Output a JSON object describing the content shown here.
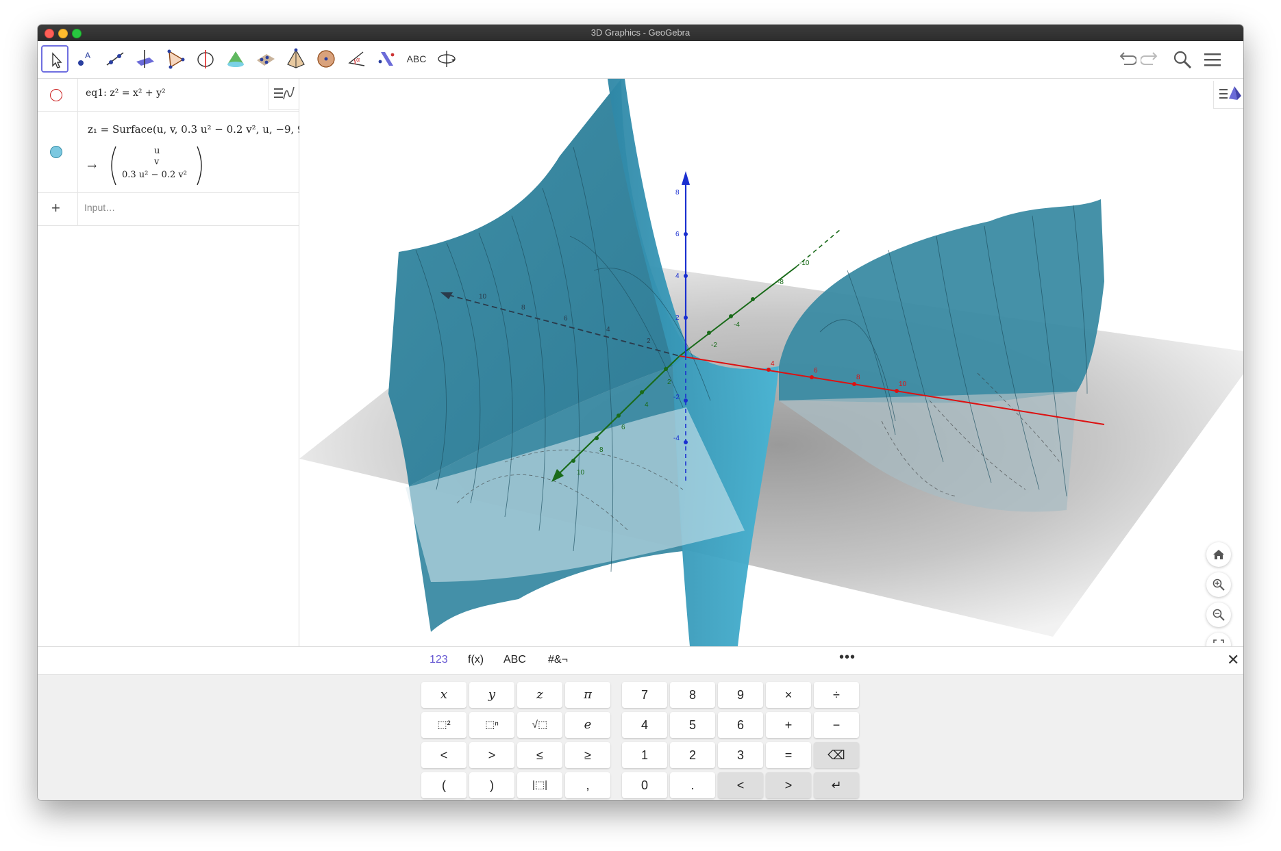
{
  "window": {
    "title": "3D Graphics - GeoGebra"
  },
  "algebra": {
    "rows": [
      {
        "text": "eq1: z² = x² + y²",
        "visible": false,
        "color": "#cc0000"
      },
      {
        "line1": "z₁ = Surface(u, v, 0.3 u² − 0.2 v², u, −9, 9,",
        "line2": "u",
        "line3": "v",
        "line4": "0.3 u² − 0.2 v²",
        "arrow": "→",
        "visible": true,
        "color": "#5bb8d8"
      }
    ],
    "input_placeholder": "Input…",
    "add_label": "+"
  },
  "axes": {
    "z_ticks": [
      "8",
      "6",
      "4",
      "2",
      "-2",
      "-4"
    ],
    "y_ticks": [
      "10",
      "8",
      "6",
      "4",
      "2",
      "-2",
      "-4",
      "-8",
      "-10"
    ],
    "x_ticks": [
      "4",
      "6",
      "8",
      "10"
    ],
    "back_ticks": [
      "10",
      "8",
      "6",
      "4",
      "2"
    ],
    "colors": {
      "x": "#dd1111",
      "y": "#1a6b1a",
      "z": "#1a2fd0",
      "surface": "#3a8fa8"
    }
  },
  "keyboard": {
    "tabs": [
      "123",
      "f(x)",
      "ABC",
      "#&¬"
    ],
    "more": "•••",
    "close": "✕",
    "left_keys": [
      [
        "x",
        "y",
        "z",
        "π"
      ],
      [
        "⬚²",
        "⬚ⁿ",
        "√⬚",
        "e"
      ],
      [
        "<",
        ">",
        "≤",
        "≥"
      ],
      [
        "(",
        ")",
        "|⬚|",
        ","
      ]
    ],
    "right_keys": [
      [
        "7",
        "8",
        "9",
        "×",
        "÷"
      ],
      [
        "4",
        "5",
        "6",
        "+",
        "−"
      ],
      [
        "1",
        "2",
        "3",
        "=",
        "⌫"
      ],
      [
        "0",
        ".",
        "<",
        ">",
        "↵"
      ]
    ]
  },
  "toolbar": {
    "tools": [
      "move-tool",
      "point-tool",
      "line-tool",
      "perpendicular-tool",
      "polygon-tool",
      "circle-axis-tool",
      "intersect-tool",
      "plane-tool",
      "pyramid-tool",
      "sphere-tool",
      "angle-tool",
      "reflect-tool",
      "text-tool",
      "rotate-view-tool"
    ],
    "text_tool_label": "ABC"
  }
}
